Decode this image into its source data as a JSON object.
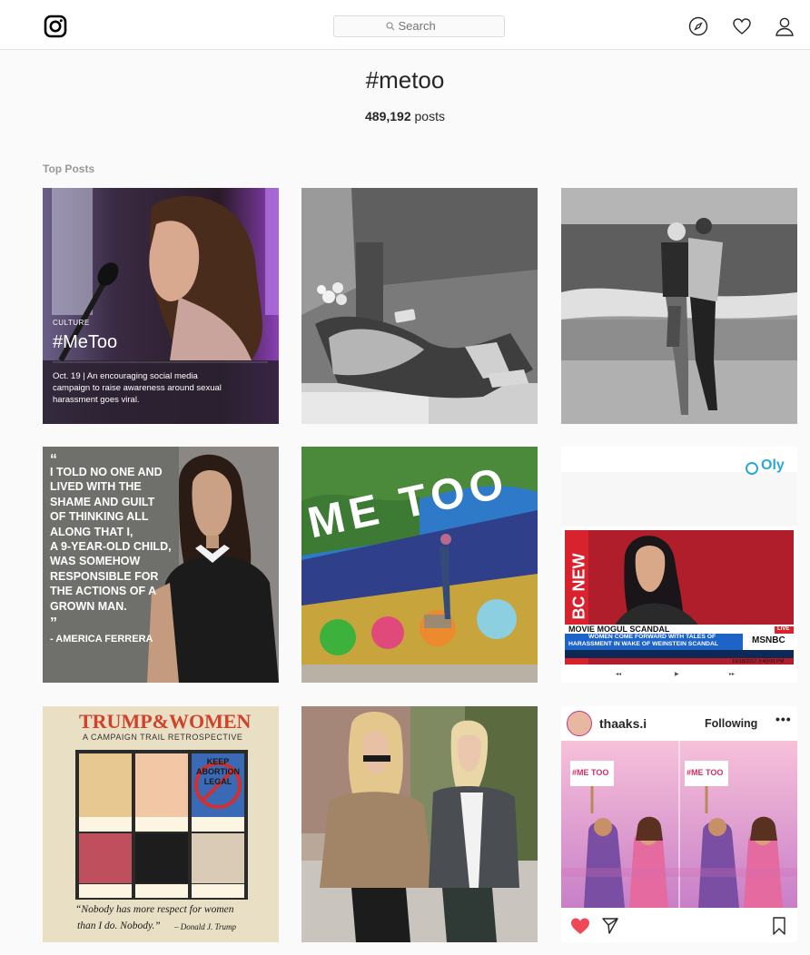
{
  "header": {
    "logo_icon": "instagram-logo-icon",
    "search_placeholder": "Search",
    "nav_icons": [
      "compass-icon",
      "heart-icon",
      "profile-icon"
    ]
  },
  "hashtag": {
    "title": "#metoo",
    "post_count": "489,192",
    "post_count_suffix": "posts"
  },
  "section_label": "Top Posts",
  "posts": [
    {
      "kicker": "CULTURE",
      "headline": "#MeToo",
      "caption_lines": [
        "Oct. 19 | An encouraging social media",
        "campaign to raise awareness around sexual",
        "harassment goes viral."
      ]
    },
    {},
    {},
    {
      "quote_open": "“",
      "quote_lines": [
        "I TOLD NO ONE AND",
        "LIVED WITH THE",
        "SHAME AND GUILT",
        "OF THINKING ALL",
        "ALONG THAT I,",
        "A 9-YEAR-OLD CHILD,",
        "WAS SOMEHOW",
        "RESPONSIBLE FOR",
        "THE ACTIONS OF A",
        "GROWN MAN."
      ],
      "quote_close": "”",
      "attribution": "- AMERICA FERRERA"
    },
    {
      "mural_text": "ME TOO"
    },
    {
      "logo_text": "Oly",
      "side_text": "BC NEW",
      "lower_third_title": "MOVIE MOGUL SCANDAL",
      "lower_third_line1": "WOMEN COME FORWARD WITH TALES OF",
      "lower_third_line2": "HARASSMENT IN WAKE OF WEINSTEIN SCANDAL",
      "network": "MSNBC",
      "live": "LIVE",
      "timestamp": "10/18/2017 3:49:00 PM"
    },
    {
      "title": "TRUMP&WOMEN",
      "subtitle": "A CAMPAIGN TRAIL RETROSPECTIVE",
      "sign_lines": [
        "KEEP",
        "ABORTION",
        "LEGAL"
      ],
      "quote": "“Nobody has more respect for women",
      "quote2": "than I do. Nobody.”",
      "signature": "– Donald J. Trump"
    },
    {},
    {
      "username": "thaaks.i",
      "follow_status": "Following",
      "more": "•••",
      "sign_text": "#ME TOO",
      "footer_icons": [
        "heart-filled-icon",
        "share-icon",
        "bookmark-icon"
      ]
    }
  ]
}
